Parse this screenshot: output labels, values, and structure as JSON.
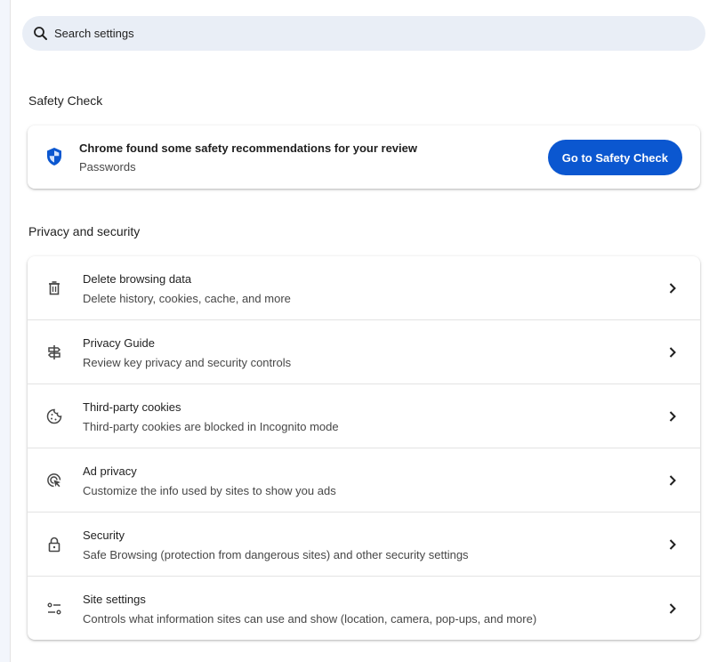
{
  "search": {
    "placeholder": "Search settings"
  },
  "safety_check": {
    "section_title": "Safety Check",
    "title": "Chrome found some safety recommendations for your review",
    "subtitle": "Passwords",
    "button_label": "Go to Safety Check",
    "icon": "shield-icon"
  },
  "privacy": {
    "section_title": "Privacy and security",
    "rows": [
      {
        "title": "Delete browsing data",
        "subtitle": "Delete history, cookies, cache, and more",
        "icon": "trash-icon"
      },
      {
        "title": "Privacy Guide",
        "subtitle": "Review key privacy and security controls",
        "icon": "signpost-icon"
      },
      {
        "title": "Third-party cookies",
        "subtitle": "Third-party cookies are blocked in Incognito mode",
        "icon": "cookie-icon"
      },
      {
        "title": "Ad privacy",
        "subtitle": "Customize the info used by sites to show you ads",
        "icon": "ad-privacy-icon"
      },
      {
        "title": "Security",
        "subtitle": "Safe Browsing (protection from dangerous sites) and other security settings",
        "icon": "lock-icon"
      },
      {
        "title": "Site settings",
        "subtitle": "Controls what information sites can use and show (location, camera, pop-ups, and more)",
        "icon": "tune-icon"
      }
    ]
  },
  "colors": {
    "accent": "#0b57d0",
    "search_background": "#e9eef6",
    "text_primary": "#1f1f1f",
    "text_secondary": "#474747",
    "divider": "#e3e3e3"
  }
}
